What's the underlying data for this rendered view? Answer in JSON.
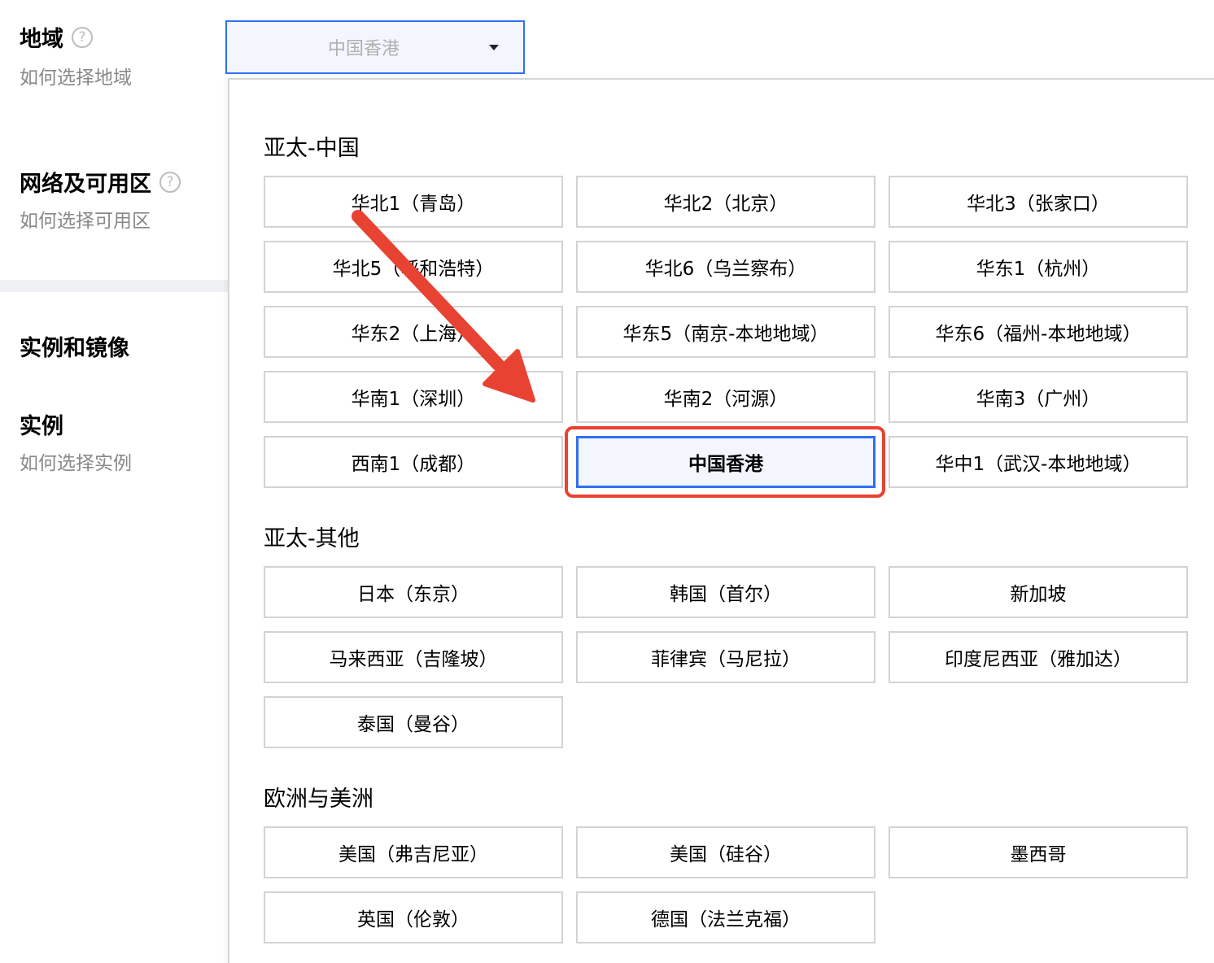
{
  "form": {
    "region": {
      "label": "地域",
      "help": "?",
      "sub": "如何选择地域"
    },
    "network": {
      "label": "网络及可用区",
      "help": "?",
      "sub": "如何选择可用区"
    },
    "section_title": "实例和镜像",
    "instance": {
      "label": "实例",
      "sub": "如何选择实例"
    }
  },
  "region_select": {
    "value": "中国香港"
  },
  "groups": [
    {
      "title": "亚太-中国",
      "options": [
        "华北1（青岛）",
        "华北2（北京）",
        "华北3（张家口）",
        "华北5（呼和浩特）",
        "华北6（乌兰察布）",
        "华东1（杭州）",
        "华东2（上海）",
        "华东5（南京-本地地域）",
        "华东6（福州-本地地域）",
        "华南1（深圳）",
        "华南2（河源）",
        "华南3（广州）",
        "西南1（成都）",
        "中国香港",
        "华中1（武汉-本地地域）"
      ]
    },
    {
      "title": "亚太-其他",
      "options": [
        "日本（东京）",
        "韩国（首尔）",
        "新加坡",
        "马来西亚（吉隆坡）",
        "菲律宾（马尼拉）",
        "印度尼西亚（雅加达）",
        "泰国（曼谷）"
      ]
    },
    {
      "title": "欧洲与美洲",
      "options": [
        "美国（弗吉尼亚）",
        "美国（硅谷）",
        "墨西哥",
        "英国（伦敦）",
        "德国（法兰克福）"
      ]
    }
  ],
  "selected_option": "中国香港",
  "colors": {
    "accent": "#2f6ff2",
    "annotation": "#e84332",
    "selected_bg": "#f3f6ff"
  }
}
